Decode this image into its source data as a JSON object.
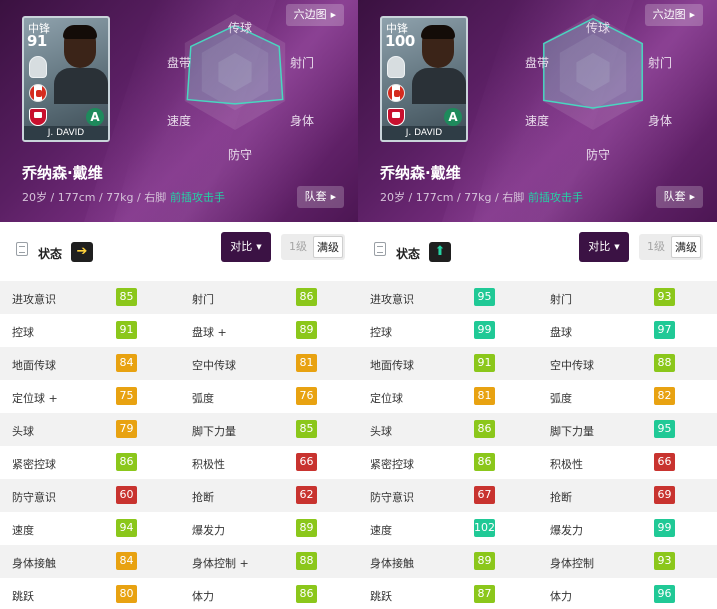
{
  "colors": {
    "tier_red": "#c8332f",
    "tier_orange": "#e8a211",
    "tier_green": "#8bc71b",
    "tier_teal": "#20c996"
  },
  "panels": [
    {
      "card": {
        "position": "中锋",
        "overall": "91",
        "grade": "A",
        "name": "J. DAVID"
      },
      "hex_button": "六边图",
      "team_button": "队套",
      "hex_labels": {
        "top": "传球",
        "upper_left": "盘带",
        "upper_right": "射门",
        "lower_left": "速度",
        "lower_right": "身体",
        "bottom": "防守"
      },
      "player_name": "乔纳森·戴维",
      "player_info": "20岁 / 177cm / 77kg / 右脚",
      "player_role": "前插攻击手",
      "status_label": "状态",
      "condition_icon": "arrow-right-icon",
      "condition_glyph": "➔",
      "compare_label": "对比",
      "levels": [
        "1级",
        "满级"
      ],
      "stats": [
        {
          "left": {
            "name": "进攻意识",
            "value": "85",
            "tier": "green"
          },
          "right": {
            "name": "射门",
            "value": "86",
            "tier": "green"
          }
        },
        {
          "left": {
            "name": "控球",
            "value": "91",
            "tier": "green"
          },
          "right": {
            "name": "盘球 +",
            "value": "89",
            "tier": "green"
          }
        },
        {
          "left": {
            "name": "地面传球",
            "value": "84",
            "tier": "orange"
          },
          "right": {
            "name": "空中传球",
            "value": "81",
            "tier": "orange"
          }
        },
        {
          "left": {
            "name": "定位球 +",
            "value": "75",
            "tier": "orange"
          },
          "right": {
            "name": "弧度",
            "value": "76",
            "tier": "orange"
          }
        },
        {
          "left": {
            "name": "头球",
            "value": "79",
            "tier": "orange"
          },
          "right": {
            "name": "脚下力量",
            "value": "85",
            "tier": "green"
          }
        },
        {
          "left": {
            "name": "紧密控球",
            "value": "86",
            "tier": "green"
          },
          "right": {
            "name": "积极性",
            "value": "66",
            "tier": "red"
          }
        },
        {
          "left": {
            "name": "防守意识",
            "value": "60",
            "tier": "red"
          },
          "right": {
            "name": "抢断",
            "value": "62",
            "tier": "red"
          }
        },
        {
          "left": {
            "name": "速度",
            "value": "94",
            "tier": "green"
          },
          "right": {
            "name": "爆发力",
            "value": "89",
            "tier": "green"
          }
        },
        {
          "left": {
            "name": "身体接触",
            "value": "84",
            "tier": "orange"
          },
          "right": {
            "name": "身体控制 +",
            "value": "88",
            "tier": "green"
          }
        },
        {
          "left": {
            "name": "跳跃",
            "value": "80",
            "tier": "orange"
          },
          "right": {
            "name": "体力",
            "value": "86",
            "tier": "green"
          }
        }
      ]
    },
    {
      "card": {
        "position": "中锋",
        "overall": "100",
        "grade": "A",
        "name": "J. DAVID"
      },
      "hex_button": "六边图",
      "team_button": "队套",
      "hex_labels": {
        "top": "传球",
        "upper_left": "盘带",
        "upper_right": "射门",
        "lower_left": "速度",
        "lower_right": "身体",
        "bottom": "防守"
      },
      "player_name": "乔纳森·戴维",
      "player_info": "20岁 / 177cm / 77kg / 右脚",
      "player_role": "前插攻击手",
      "status_label": "状态",
      "condition_icon": "arrow-up-icon",
      "condition_glyph": "⬆",
      "compare_label": "对比",
      "levels": [
        "1级",
        "满级"
      ],
      "stats": [
        {
          "left": {
            "name": "进攻意识",
            "value": "95",
            "tier": "teal"
          },
          "right": {
            "name": "射门",
            "value": "93",
            "tier": "green"
          }
        },
        {
          "left": {
            "name": "控球",
            "value": "99",
            "tier": "teal"
          },
          "right": {
            "name": "盘球",
            "value": "97",
            "tier": "teal"
          }
        },
        {
          "left": {
            "name": "地面传球",
            "value": "91",
            "tier": "green"
          },
          "right": {
            "name": "空中传球",
            "value": "88",
            "tier": "green"
          }
        },
        {
          "left": {
            "name": "定位球",
            "value": "81",
            "tier": "orange"
          },
          "right": {
            "name": "弧度",
            "value": "82",
            "tier": "orange"
          }
        },
        {
          "left": {
            "name": "头球",
            "value": "86",
            "tier": "green"
          },
          "right": {
            "name": "脚下力量",
            "value": "95",
            "tier": "teal"
          }
        },
        {
          "left": {
            "name": "紧密控球",
            "value": "86",
            "tier": "green"
          },
          "right": {
            "name": "积极性",
            "value": "66",
            "tier": "red"
          }
        },
        {
          "left": {
            "name": "防守意识",
            "value": "67",
            "tier": "red"
          },
          "right": {
            "name": "抢断",
            "value": "69",
            "tier": "red"
          }
        },
        {
          "left": {
            "name": "速度",
            "value": "102",
            "tier": "teal"
          },
          "right": {
            "name": "爆发力",
            "value": "99",
            "tier": "teal"
          }
        },
        {
          "left": {
            "name": "身体接触",
            "value": "89",
            "tier": "green"
          },
          "right": {
            "name": "身体控制",
            "value": "93",
            "tier": "green"
          }
        },
        {
          "left": {
            "name": "跳跃",
            "value": "87",
            "tier": "green"
          },
          "right": {
            "name": "体力",
            "value": "96",
            "tier": "teal"
          }
        }
      ]
    }
  ]
}
